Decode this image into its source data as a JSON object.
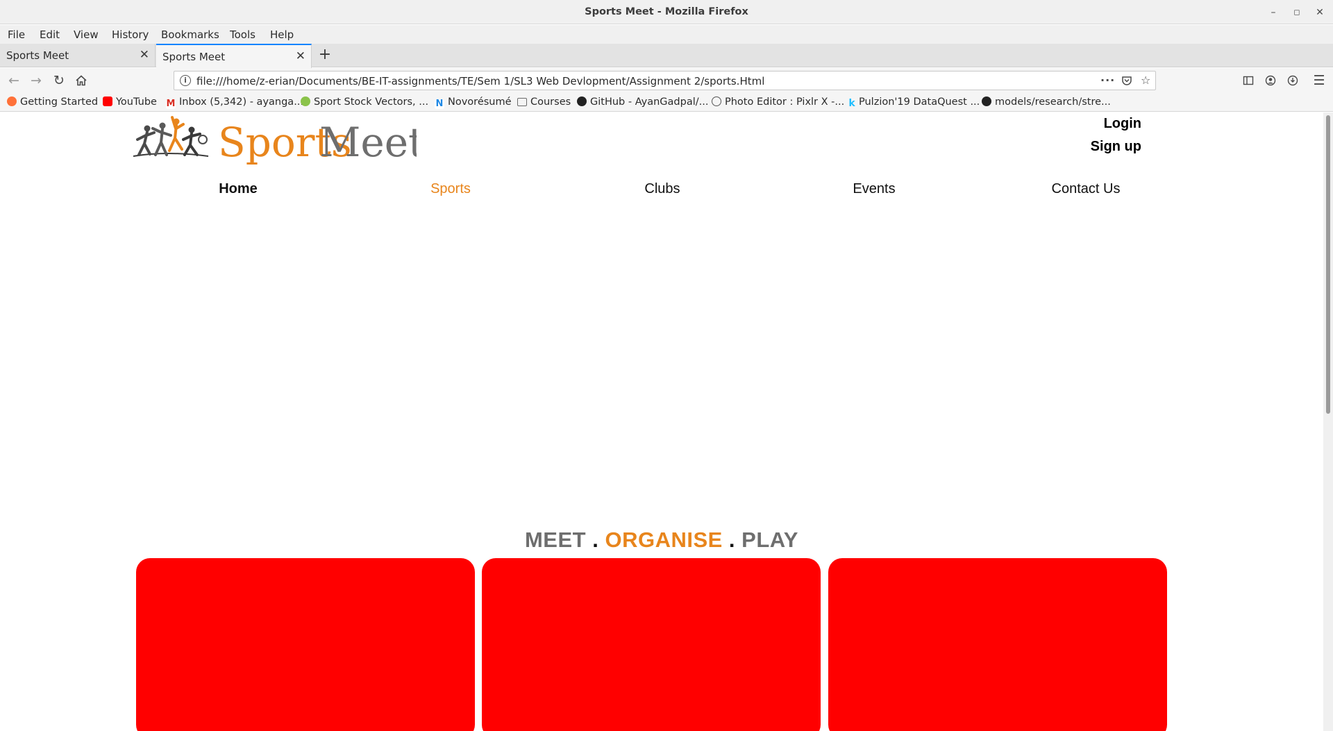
{
  "window": {
    "title": "Sports Meet - Mozilla Firefox"
  },
  "menu": [
    "File",
    "Edit",
    "View",
    "History",
    "Bookmarks",
    "Tools",
    "Help"
  ],
  "tabs": [
    {
      "label": "Sports Meet",
      "active": false
    },
    {
      "label": "Sports Meet",
      "active": true
    }
  ],
  "address": {
    "url": "file:///home/z-erian/Documents/BE-IT-assignments/TE/Sem 1/SL3 Web Devlopment/Assignment 2/sports.Html"
  },
  "bookmarks": [
    {
      "label": "Getting Started",
      "icon": "firefox-icon",
      "color": "#ff7139"
    },
    {
      "label": "YouTube",
      "icon": "youtube-icon",
      "color": "#ff0000"
    },
    {
      "label": "Inbox (5,342) - ayanga...",
      "icon": "gmail-icon",
      "color": "#d93025"
    },
    {
      "label": "Sport Stock Vectors, ...",
      "icon": "freepik-icon",
      "color": "#8bc34a"
    },
    {
      "label": "Novorésumé",
      "icon": "novoresume-icon",
      "color": "#1e88e5"
    },
    {
      "label": "Courses",
      "icon": "folder-icon",
      "color": "#6b6b6b"
    },
    {
      "label": "GitHub - AyanGadpal/...",
      "icon": "github-icon",
      "color": "#222222"
    },
    {
      "label": "Photo Editor : Pixlr X -...",
      "icon": "pixlr-icon",
      "color": "#555555"
    },
    {
      "label": "Pulzion'19 DataQuest ...",
      "icon": "kaggle-icon",
      "color": "#20beff"
    },
    {
      "label": "models/research/stre...",
      "icon": "github-icon",
      "color": "#222222"
    }
  ],
  "site": {
    "logo": {
      "part1": "Sports",
      "part2": "Meets"
    },
    "auth": {
      "login": "Login",
      "signup": "Sign up"
    },
    "nav": [
      {
        "label": "Home",
        "state": "current"
      },
      {
        "label": "Sports",
        "state": "highlight"
      },
      {
        "label": "Clubs",
        "state": "normal"
      },
      {
        "label": "Events",
        "state": "normal"
      },
      {
        "label": "Contact Us",
        "state": "normal"
      }
    ],
    "tagline": {
      "meet": "MEET",
      "dot1": " . ",
      "organise": "ORGANISE",
      "dot2": " . ",
      "play": "PLAY"
    },
    "cards": 3
  },
  "colors": {
    "accent": "#e8851c",
    "gray": "#6e6e6e",
    "card": "#ff0000",
    "tab_highlight": "#0a84ff"
  }
}
